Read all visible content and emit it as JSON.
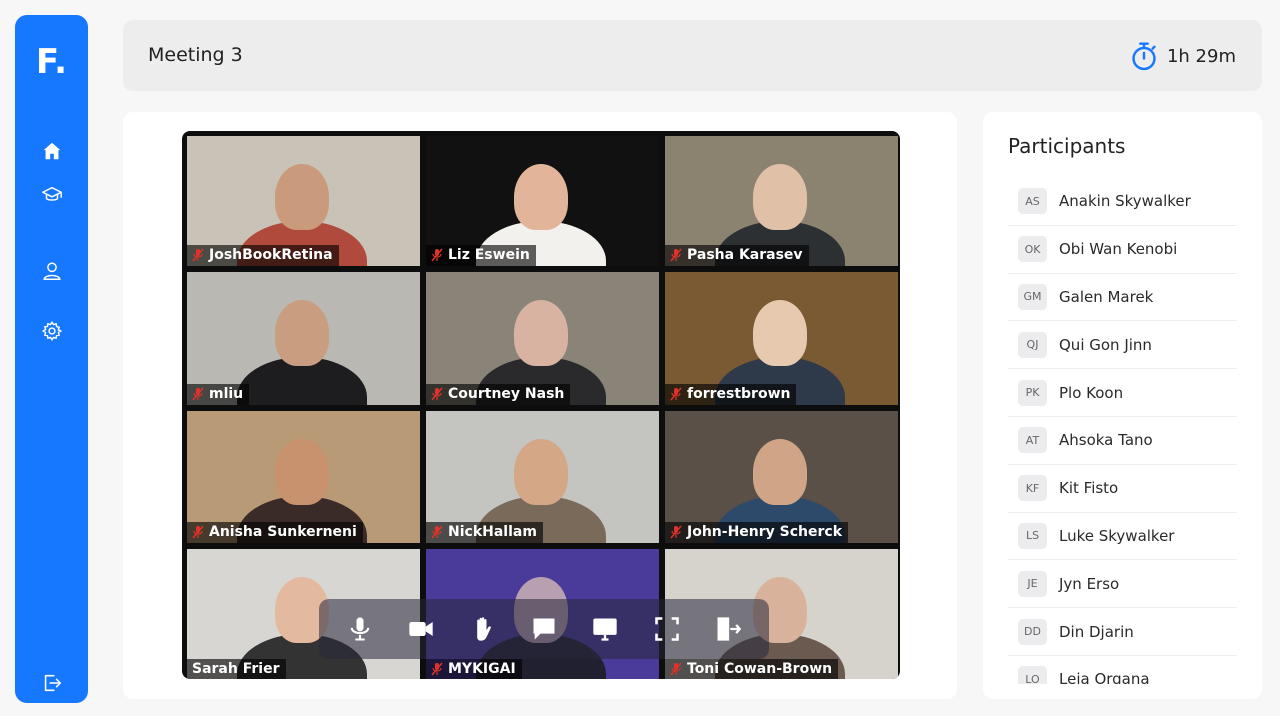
{
  "app": {
    "logo": "F",
    "logo_dot": "."
  },
  "nav": {
    "items": [
      {
        "name": "home",
        "icon": "home-icon"
      },
      {
        "name": "courses",
        "icon": "graduation-cap-icon"
      },
      {
        "name": "profile",
        "icon": "user-icon"
      },
      {
        "name": "settings",
        "icon": "gear-icon"
      }
    ],
    "logout_icon": "logout-icon"
  },
  "header": {
    "title": "Meeting 3",
    "timer": "1h 29m",
    "timer_icon": "stopwatch-icon"
  },
  "video": {
    "tiles": [
      {
        "name": "JoshBookRetina",
        "muted": true,
        "bg": "#c9c2b6",
        "skin": "#c99a7b",
        "shirt": "#b04a3c"
      },
      {
        "name": "Liz Eswein",
        "muted": true,
        "bg": "#111111",
        "skin": "#e2b59b",
        "shirt": "#f3f1ee"
      },
      {
        "name": "Pasha Karasev",
        "muted": true,
        "bg": "#8c8270",
        "skin": "#e1c0a8",
        "shirt": "#2c3033"
      },
      {
        "name": "mliu",
        "muted": true,
        "bg": "#b9b8b3",
        "skin": "#c99d80",
        "shirt": "#1d1d1f"
      },
      {
        "name": "Courtney Nash",
        "muted": true,
        "bg": "#8a8378",
        "skin": "#d9b3a1",
        "shirt": "#2a2a2d"
      },
      {
        "name": "forrestbrown",
        "muted": true,
        "bg": "#7a5a32",
        "skin": "#e7c9b0",
        "shirt": "#2e3a4a"
      },
      {
        "name": "Anisha Sunkerneni",
        "muted": true,
        "bg": "#b89a76",
        "skin": "#c8926f",
        "shirt": "#3a2a28"
      },
      {
        "name": "NickHallam",
        "muted": true,
        "bg": "#c4c4c1",
        "skin": "#d4a787",
        "shirt": "#7a6a5a"
      },
      {
        "name": "John-Henry Scherck",
        "muted": true,
        "bg": "#5a5048",
        "skin": "#d0a587",
        "shirt": "#2e4a6a"
      },
      {
        "name": "Sarah Frier",
        "muted": false,
        "bg": "#d8d6d2",
        "skin": "#e3b9a0",
        "shirt": "#333333"
      },
      {
        "name": "MYKIGAI",
        "muted": true,
        "bg": "#4a3a9a",
        "skin": "#b8a0b0",
        "shirt": "#202030"
      },
      {
        "name": "Toni Cowan-Brown",
        "muted": true,
        "bg": "#d6d2cc",
        "skin": "#d8b29a",
        "shirt": "#6a5a50"
      }
    ],
    "controls": [
      {
        "name": "mic",
        "icon": "microphone-icon"
      },
      {
        "name": "camera",
        "icon": "video-camera-icon"
      },
      {
        "name": "raise-hand",
        "icon": "hand-icon"
      },
      {
        "name": "chat",
        "icon": "chat-icon"
      },
      {
        "name": "share-screen",
        "icon": "monitor-icon"
      },
      {
        "name": "fullscreen",
        "icon": "fullscreen-icon"
      },
      {
        "name": "leave",
        "icon": "exit-icon"
      }
    ]
  },
  "participants": {
    "title": "Participants",
    "list": [
      {
        "initials": "AS",
        "name": "Anakin Skywalker"
      },
      {
        "initials": "OK",
        "name": "Obi Wan Kenobi"
      },
      {
        "initials": "GM",
        "name": "Galen Marek"
      },
      {
        "initials": "QJ",
        "name": "Qui Gon Jinn"
      },
      {
        "initials": "PK",
        "name": "Plo Koon"
      },
      {
        "initials": "AT",
        "name": "Ahsoka Tano"
      },
      {
        "initials": "KF",
        "name": "Kit Fisto"
      },
      {
        "initials": "LS",
        "name": "Luke Skywalker"
      },
      {
        "initials": "JE",
        "name": "Jyn Erso"
      },
      {
        "initials": "DD",
        "name": "Din Djarin"
      },
      {
        "initials": "LO",
        "name": "Leia Organa"
      }
    ]
  },
  "colors": {
    "accent": "#1677ff",
    "muted_red": "#e0322a"
  }
}
